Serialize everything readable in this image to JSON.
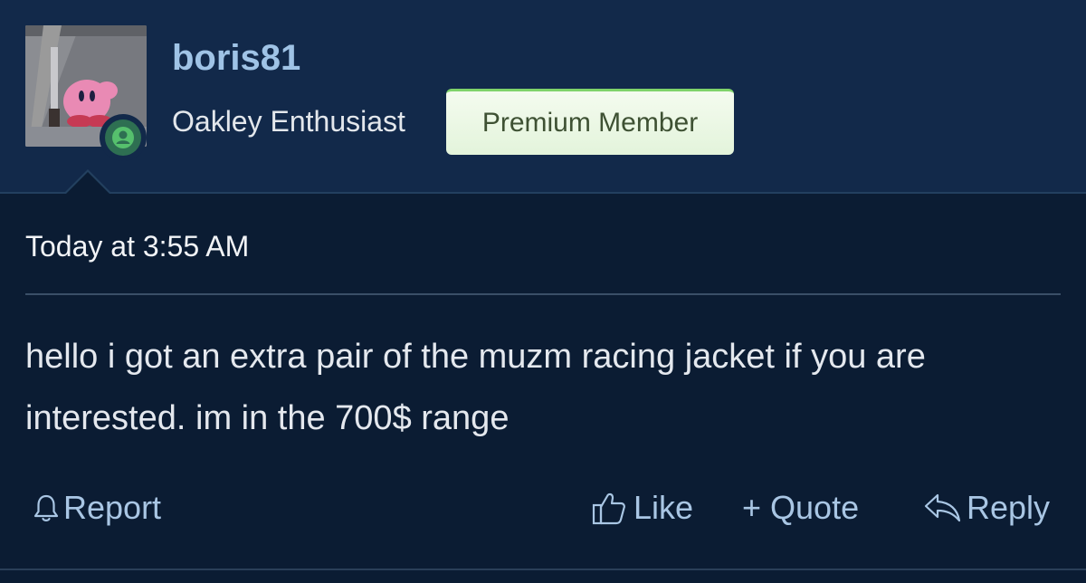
{
  "post": {
    "author": {
      "username": "boris81",
      "user_title": "Oakley Enthusiast",
      "badge": "Premium Member",
      "presence": "online"
    },
    "timestamp": "Today at 3:55 AM",
    "message": "hello i got an extra pair of the muzm racing jacket if you are interested. im in the 700$ range",
    "actions": {
      "report": "Report",
      "like": "Like",
      "quote": "+ Quote",
      "reply": "Reply"
    }
  },
  "icons": {
    "report": "bell-icon",
    "like": "thumbs-up-icon",
    "reply": "reply-arrow-icon",
    "presence": "user-online-icon"
  },
  "colors": {
    "header_bg": "#12294a",
    "body_bg": "#0b1c33",
    "username": "#9fc3e6",
    "link": "#a9c6e4",
    "badge_accent": "#7fd36a",
    "presence": "#2e6f52"
  }
}
